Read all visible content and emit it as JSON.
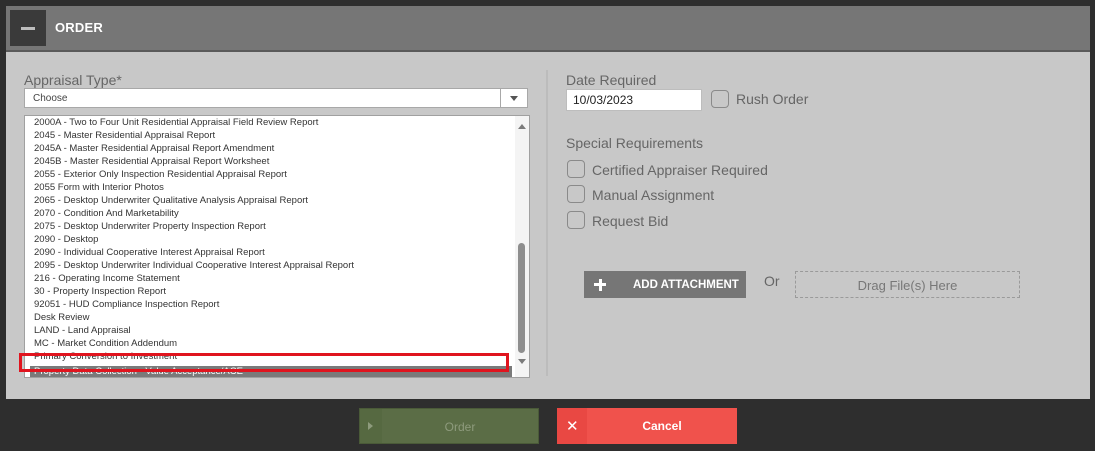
{
  "panel": {
    "title": "ORDER"
  },
  "left": {
    "appraisal_label": "Appraisal Type*",
    "select_value": "Choose",
    "options": [
      "2000A - Two to Four Unit Residential Appraisal Field Review Report",
      "2045 - Master Residential Appraisal Report",
      "2045A - Master Residential Appraisal Report Amendment",
      "2045B - Master Residential Appraisal Report Worksheet",
      "2055 - Exterior Only Inspection Residential Appraisal Report",
      "2055 Form with Interior Photos",
      "2065 - Desktop Underwriter Qualitative Analysis Appraisal Report",
      "2070 - Condition And Marketability",
      "2075 - Desktop Underwriter Property Inspection Report",
      "2090 - Desktop",
      "2090 - Individual Cooperative Interest Appraisal Report",
      "2095 - Desktop Underwriter Individual Cooperative Interest Appraisal Report",
      "216 - Operating Income Statement",
      "30 - Property Inspection Report",
      "92051 - HUD Compliance Inspection Report",
      "Desk Review",
      "LAND - Land Appraisal",
      "MC - Market Condition Addendum",
      "Primary Conversion to Investment"
    ],
    "selected_option": "Property Data Collection - Value Acceptance/ACE"
  },
  "right": {
    "date_label": "Date Required",
    "date_value": "10/03/2023",
    "rush_label": "Rush Order",
    "special_label": "Special Requirements",
    "requirements": [
      "Certified Appraiser Required",
      "Manual Assignment",
      "Request Bid"
    ],
    "attach_label": "ADD ATTACHMENT",
    "or_text": "Or",
    "drop_label": "Drag File(s) Here"
  },
  "footer": {
    "order_label": "Order",
    "cancel_label": "Cancel"
  },
  "colors": {
    "highlight": "#e0141e",
    "cancel": "#f0524c",
    "order": "#5b6d46"
  },
  "icons": {
    "collapse": "minus-icon",
    "attach": "plus-icon",
    "order": "play-icon",
    "cancel": "close-icon"
  }
}
